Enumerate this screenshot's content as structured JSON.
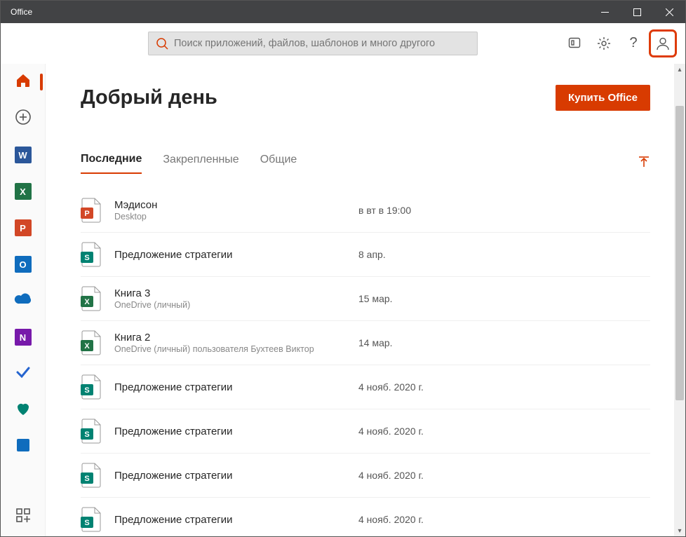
{
  "window_title": "Office",
  "search": {
    "placeholder": "Поиск приложений, файлов, шаблонов и много другого"
  },
  "greeting": "Добрый день",
  "buy_button": "Купить Office",
  "tabs": {
    "recent": "Последние",
    "pinned": "Закрепленные",
    "shared": "Общие"
  },
  "sidebar_apps": [
    {
      "name": "home",
      "label": "Главная",
      "kind": "home",
      "active": true
    },
    {
      "name": "new",
      "label": "Создать",
      "kind": "plus"
    },
    {
      "name": "word",
      "label": "Word",
      "kind": "app",
      "letter": "W",
      "color": "#2b579a"
    },
    {
      "name": "excel",
      "label": "Excel",
      "kind": "app",
      "letter": "X",
      "color": "#217346"
    },
    {
      "name": "powerpoint",
      "label": "PowerPoint",
      "kind": "app",
      "letter": "P",
      "color": "#d24726"
    },
    {
      "name": "outlook",
      "label": "Outlook",
      "kind": "app",
      "letter": "O",
      "color": "#0f6cbd"
    },
    {
      "name": "onedrive",
      "label": "OneDrive",
      "kind": "cloud"
    },
    {
      "name": "onenote",
      "label": "OneNote",
      "kind": "app",
      "letter": "N",
      "color": "#7719aa"
    },
    {
      "name": "todo",
      "label": "To Do",
      "kind": "check"
    },
    {
      "name": "family",
      "label": "Family",
      "kind": "heart"
    },
    {
      "name": "more",
      "label": "Другое",
      "kind": "square"
    }
  ],
  "files": [
    {
      "icon": "powerpoint",
      "name": "Мэдисон",
      "location": "Desktop",
      "date": "в вт в 19:00"
    },
    {
      "icon": "sway",
      "name": "Предложение стратегии",
      "location": "",
      "date": "8 апр."
    },
    {
      "icon": "excel",
      "name": "Книга 3",
      "location": "OneDrive (личный)",
      "date": "15 мар."
    },
    {
      "icon": "excel",
      "name": "Книга 2",
      "location": "OneDrive (личный) пользователя Бухтеев Виктор",
      "date": "14 мар."
    },
    {
      "icon": "sway",
      "name": "Предложение стратегии",
      "location": "",
      "date": "4 нояб. 2020 г."
    },
    {
      "icon": "sway",
      "name": "Предложение стратегии",
      "location": "",
      "date": "4 нояб. 2020 г."
    },
    {
      "icon": "sway",
      "name": "Предложение стратегии",
      "location": "",
      "date": "4 нояб. 2020 г."
    },
    {
      "icon": "sway",
      "name": "Предложение стратегии",
      "location": "",
      "date": "4 нояб. 2020 г."
    }
  ]
}
